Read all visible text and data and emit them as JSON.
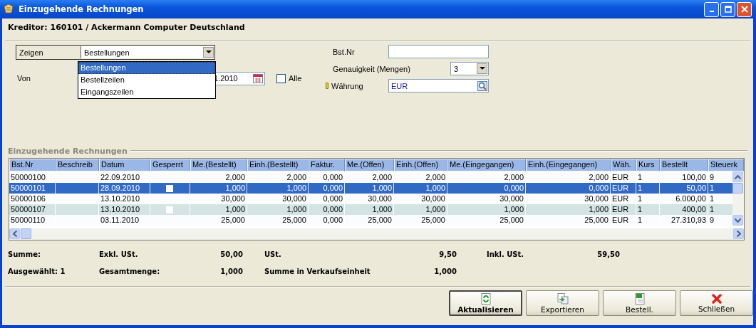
{
  "window": {
    "title": "Einzugehende Rechnungen"
  },
  "creditor": "Kreditor: 160101 / Ackermann Computer Deutschland",
  "filters": {
    "show_label": "Zeigen",
    "show_value": "Bestellungen",
    "show_options": [
      {
        "label": "Bestellungen",
        "selected": true
      },
      {
        "label": "Bestellzeilen",
        "selected": false
      },
      {
        "label": "Eingangszeilen",
        "selected": false
      }
    ],
    "from_label": "Von",
    "from_value": "1.2010",
    "all_label": "Alle",
    "all_checked": false,
    "order_no_label": "Bst.Nr",
    "precision_label": "Genauigkeit (Mengen)",
    "precision_value": "3",
    "currency_label": "Währung",
    "currency_value": "EUR"
  },
  "group_title": "Einzugehende Rechnungen",
  "table": {
    "columns": [
      {
        "label": "Bst.Nr",
        "kind": "text"
      },
      {
        "label": "Beschreib",
        "kind": "blank"
      },
      {
        "label": "Datum",
        "kind": "text"
      },
      {
        "label": "Gesperrt",
        "kind": "check"
      },
      {
        "label": "Me.(Bestellt)",
        "kind": "number"
      },
      {
        "label": "Einh.(Bestellt)",
        "kind": "number"
      },
      {
        "label": "Faktur.",
        "kind": "number"
      },
      {
        "label": "Me.(Offen)",
        "kind": "number"
      },
      {
        "label": "Einh.(Offen)",
        "kind": "number"
      },
      {
        "label": "Me.(Eingegangen)",
        "kind": "number"
      },
      {
        "label": "Einh.(Eingegangen)",
        "kind": "number"
      },
      {
        "label": "Wäh.",
        "kind": "text"
      },
      {
        "label": "Kurs",
        "kind": "text"
      },
      {
        "label": "Bestellt",
        "kind": "number"
      },
      {
        "label": "Steuerk",
        "kind": "text"
      }
    ],
    "rows": [
      {
        "selected": false,
        "highlighted": false,
        "locked": false,
        "cells": [
          "50000100",
          "",
          "22.09.2010",
          "",
          "2,000",
          "2,000",
          "0,000",
          "2,000",
          "2,000",
          "2,000",
          "2,000",
          "EUR",
          "1",
          "100,00",
          "9"
        ]
      },
      {
        "selected": true,
        "highlighted": false,
        "locked": false,
        "cells": [
          "50000101",
          "",
          "28.09.2010",
          "",
          "1,000",
          "1,000",
          "0,000",
          "1,000",
          "1,000",
          "0,000",
          "0,000",
          "EUR",
          "1",
          "50,00",
          "1"
        ]
      },
      {
        "selected": false,
        "highlighted": false,
        "locked": false,
        "cells": [
          "50000106",
          "",
          "13.10.2010",
          "",
          "30,000",
          "30,000",
          "0,000",
          "30,000",
          "30,000",
          "30,000",
          "30,000",
          "EUR",
          "1",
          "6.000,00",
          "1"
        ]
      },
      {
        "selected": false,
        "highlighted": true,
        "locked": false,
        "cells": [
          "50000107",
          "",
          "13.10.2010",
          "",
          "1,000",
          "1,000",
          "0,000",
          "1,000",
          "1,000",
          "1,000",
          "1,000",
          "EUR",
          "1",
          "400,00",
          "1"
        ]
      },
      {
        "selected": false,
        "highlighted": false,
        "locked": false,
        "cells": [
          "50000110",
          "",
          "03.11.2010",
          "",
          "25,000",
          "25,000",
          "0,000",
          "25,000",
          "25,000",
          "25,000",
          "25,000",
          "EUR",
          "1",
          "27.310,93",
          "9"
        ]
      }
    ]
  },
  "summary": [
    [
      {
        "kind": "label",
        "text": "Summe:"
      },
      {
        "kind": "label",
        "text": "Exkl. USt."
      },
      {
        "kind": "value",
        "text": "50,00"
      },
      {
        "kind": "label",
        "text": "USt."
      },
      {
        "kind": "value",
        "text": "9,50"
      },
      {
        "kind": "label",
        "text": "Inkl. USt."
      },
      {
        "kind": "value",
        "text": "59,50"
      }
    ],
    [
      {
        "kind": "label",
        "text": "Ausgewählt: 1"
      },
      {
        "kind": "label",
        "text": "Gesamtmenge:"
      },
      {
        "kind": "value",
        "text": "1,000"
      },
      {
        "kind": "label",
        "text": "Summe in Verkaufseinheit"
      },
      {
        "kind": "value",
        "text": "1,000"
      }
    ]
  ],
  "buttons": [
    {
      "label": "Aktualisieren",
      "kind": "refresh",
      "default": true
    },
    {
      "label": "Exportieren",
      "kind": "export",
      "default": false
    },
    {
      "label": "Bestell.",
      "kind": "order",
      "default": false
    },
    {
      "label": "Schließen",
      "kind": "close",
      "default": false
    }
  ]
}
